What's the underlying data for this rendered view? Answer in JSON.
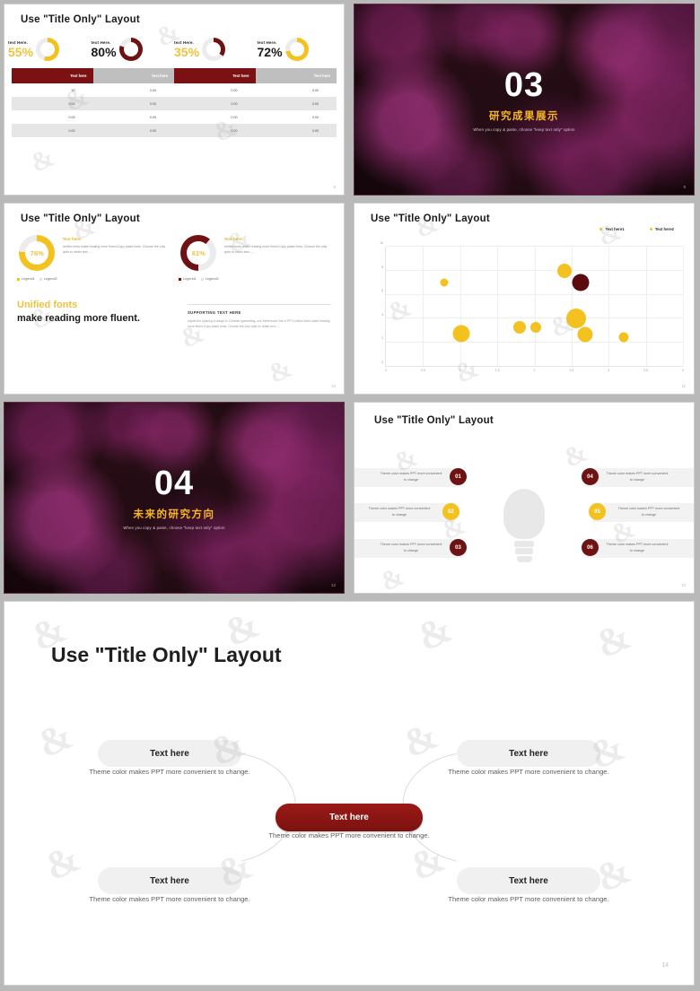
{
  "theme": {
    "gold": "#F3C220",
    "gold_light": "#F5CE3F",
    "dark_red": "#7B1113",
    "deep_red": "#6E0F11",
    "grey": "#BFBFBF",
    "light_grey": "#E6E6E6"
  },
  "slides": [
    {
      "id": "slide-kpi-table",
      "title": "Use \"Title Only\" Layout",
      "page": "8",
      "kpis": [
        {
          "label": "text Here.",
          "value": "55%",
          "pct": 55,
          "color": "#F3C220",
          "value_color": "#F0C33C"
        },
        {
          "label": "text Here.",
          "value": "80%",
          "pct": 80,
          "color": "#6E1214",
          "value_color": "#1A1A1A"
        },
        {
          "label": "text Here.",
          "value": "35%",
          "pct": 35,
          "color": "#6E1214",
          "value_color": "#F0C33C"
        },
        {
          "label": "text Here.",
          "value": "72%",
          "pct": 72,
          "color": "#F3C220",
          "value_color": "#1A1A1A"
        }
      ],
      "table": {
        "headers": [
          "Text here",
          "Text here",
          "Text here",
          "Text here"
        ],
        "header_colors": [
          "#7B1113",
          "#BFBFBF",
          "#7B1113",
          "#BFBFBF"
        ],
        "rows": [
          [
            "90",
            "0.00",
            "0.00",
            "0.00"
          ],
          [
            "0.00",
            "0.00",
            "0.00",
            "0.00"
          ],
          [
            "0.00",
            "0.00",
            "0.00",
            "0.00"
          ],
          [
            "0.00",
            "0.00",
            "0.00",
            "0.00"
          ]
        ]
      }
    },
    {
      "id": "slide-section-03",
      "number": "03",
      "title_cn": "研究成果展示",
      "subtitle_en": "When you copy & paste, choose \"keep text only\" option",
      "page": "9"
    },
    {
      "id": "slide-donuts-text",
      "title": "Use \"Title Only\" Layout",
      "page": "10",
      "donuts": [
        {
          "value": "76%",
          "pct": 76,
          "color": "#F3C220",
          "text_color": "#F0C33C",
          "heading": "Text here.",
          "body": "Unified fonts make reading more fluent.Copy paste fonts. Choose the only optio to retain text.......",
          "legend": [
            "Legend1",
            "Legend2"
          ]
        },
        {
          "value": "61%",
          "pct": 61,
          "color": "#6E1214",
          "text_color": "#F0C33C",
          "heading": "Text here.",
          "body": "Unified fonts make reading more fluent.Copy paste fonts. Choose the only optio to retain text.......",
          "legend": [
            "Legend1",
            "Legend2"
          ]
        }
      ],
      "statement_gold": "Unified fonts",
      "statement_black": "make reading more fluent.",
      "support_heading": "SUPPORTING TEXT HERE",
      "support_body": "Adjust the spacing to adapt to Chinese typesetting, use thellerence line in PPT.Unified fonts make reading more fluent.Copy paste fonts. Choose the only optio to retain text......"
    },
    {
      "id": "slide-bubble-chart",
      "title": "Use \"Title Only\" Layout",
      "page": "11"
    },
    {
      "id": "slide-section-04",
      "number": "04",
      "title_cn": "未来的研究方向",
      "subtitle_en": "When you copy & paste, choose \"keep text only\" option",
      "page": "12"
    },
    {
      "id": "slide-bulb",
      "title": "Use \"Title Only\" Layout",
      "page": "13",
      "items": [
        {
          "num": "01",
          "color": "#6E1214",
          "text": "Theme  color makes PPT more convenient to change"
        },
        {
          "num": "02",
          "color": "#F3C220",
          "text": "Theme  color makes PPT more convenient to change"
        },
        {
          "num": "03",
          "color": "#6E1214",
          "text": "Theme  color makes PPT more convenient to change"
        },
        {
          "num": "04",
          "color": "#6E1214",
          "text": "Theme  color makes PPT more convenient to change"
        },
        {
          "num": "05",
          "color": "#F3C220",
          "text": "Theme  color makes PPT more convenient to change"
        },
        {
          "num": "06",
          "color": "#6E1214",
          "text": "Theme  color makes PPT more convenient to change"
        }
      ]
    },
    {
      "id": "slide-hub-spoke",
      "title": "Use \"Title Only\" Layout",
      "page": "14",
      "center": {
        "label": "Text here",
        "caption": "Theme color makes PPT more convenient to change."
      },
      "nodes": [
        {
          "label": "Text here",
          "caption": "Theme color makes PPT more convenient to change."
        },
        {
          "label": "Text here",
          "caption": "Theme color makes PPT more convenient to change."
        },
        {
          "label": "Text here",
          "caption": "Theme color makes PPT more convenient to change."
        },
        {
          "label": "Text here",
          "caption": "Theme color makes PPT more convenient to change."
        }
      ]
    }
  ],
  "chart_data": {
    "type": "scatter",
    "title": "Use \"Title Only\" Layout",
    "xlabel": "",
    "ylabel": "",
    "xlim": [
      0,
      4
    ],
    "ylim": [
      0,
      10
    ],
    "xticks": [
      "0",
      "0.5",
      "1",
      "1.5",
      "2",
      "2.5",
      "3",
      "3.5",
      "4"
    ],
    "yticks": [
      "0",
      "2",
      "4",
      "6",
      "8",
      "10"
    ],
    "grid": true,
    "legend_position": "top-right",
    "legend": [
      "Text here1",
      "Text here2"
    ],
    "series": [
      {
        "name": "Text here1",
        "color": "#F3C220",
        "points": [
          {
            "x": 0.78,
            "y": 7.0,
            "size": 9
          },
          {
            "x": 1.02,
            "y": 2.7,
            "size": 19
          },
          {
            "x": 1.8,
            "y": 3.2,
            "size": 14
          },
          {
            "x": 2.02,
            "y": 3.2,
            "size": 12
          },
          {
            "x": 2.4,
            "y": 8.0,
            "size": 16
          },
          {
            "x": 2.56,
            "y": 4.0,
            "size": 22
          },
          {
            "x": 2.68,
            "y": 2.6,
            "size": 17
          },
          {
            "x": 3.2,
            "y": 2.4,
            "size": 11
          }
        ]
      },
      {
        "name": "Text here2",
        "color": "#5C0C0E",
        "points": [
          {
            "x": 2.62,
            "y": 7.0,
            "size": 19
          }
        ]
      }
    ]
  }
}
